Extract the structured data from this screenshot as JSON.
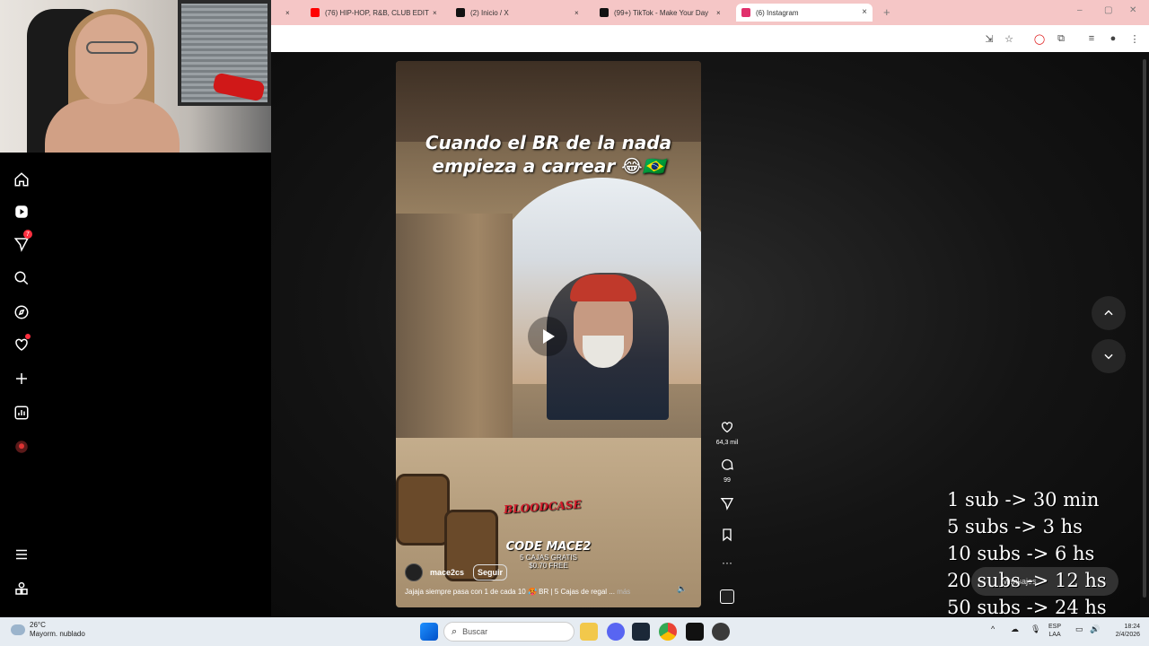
{
  "browser": {
    "tabs": [
      {
        "label": "(76) HIP-HOP, R&B, CLUB EDIT",
        "icon": "youtube-icon",
        "color": "#ff0000",
        "active": false
      },
      {
        "label": "(2) Inicio / X",
        "icon": "x-icon",
        "color": "#000000",
        "active": false
      },
      {
        "label": "(99+) TikTok - Make Your Day",
        "icon": "tiktok-icon",
        "color": "#000000",
        "active": false
      },
      {
        "label": "(6) Instagram",
        "icon": "instagram-icon",
        "color": "#e1306c",
        "active": true
      }
    ],
    "new_tab": "+",
    "tab_close": "×"
  },
  "sidebar": {
    "items": [
      {
        "name": "home-icon"
      },
      {
        "name": "reels-icon"
      },
      {
        "name": "direct-icon",
        "badge": "7"
      },
      {
        "name": "search-icon"
      },
      {
        "name": "explore-icon"
      },
      {
        "name": "notifications-icon"
      },
      {
        "name": "create-icon"
      },
      {
        "name": "dashboard-icon"
      },
      {
        "name": "profile-avatar"
      },
      {
        "name": "menu-icon"
      },
      {
        "name": "more-apps-icon"
      }
    ]
  },
  "reel": {
    "title_line1": "Cuando el BR de la nada",
    "title_line2": "empieza a carrear 😂🇧🇷",
    "brand_logo": "BLOODCASE",
    "promo_code": "CODE MACE2",
    "promo_line1": "5 CAJAS GRATIS",
    "promo_line2": "$0.70 FREE",
    "username": "mace2cs",
    "follow_label": "Seguir",
    "caption": "Jajaja siempre pasa con 1 de cada 10 🥵 BR | 5 Cajas de regal ...",
    "caption_more": "más",
    "likes": "64,3 mil",
    "comments": "99"
  },
  "messages_label": "Mensajes",
  "overlay": {
    "lines": [
      "1 sub -> 30 min",
      "5 subs -> 3 hs",
      "10 subs -> 6 hs",
      "20 subs -> 12 hs",
      "50 subs -> 24 hs"
    ]
  },
  "taskbar": {
    "temperature": "26°C",
    "weather": "Mayorm. nublado",
    "search_placeholder": "Buscar",
    "lang_top": "ESP",
    "lang_bottom": "LAA",
    "time": "18:24",
    "date": "2/4/2026"
  },
  "colors": {
    "tabstrip": "#f5c6c6",
    "instagram_badge": "#ff3040",
    "taskbar": "#e6ecf2"
  }
}
